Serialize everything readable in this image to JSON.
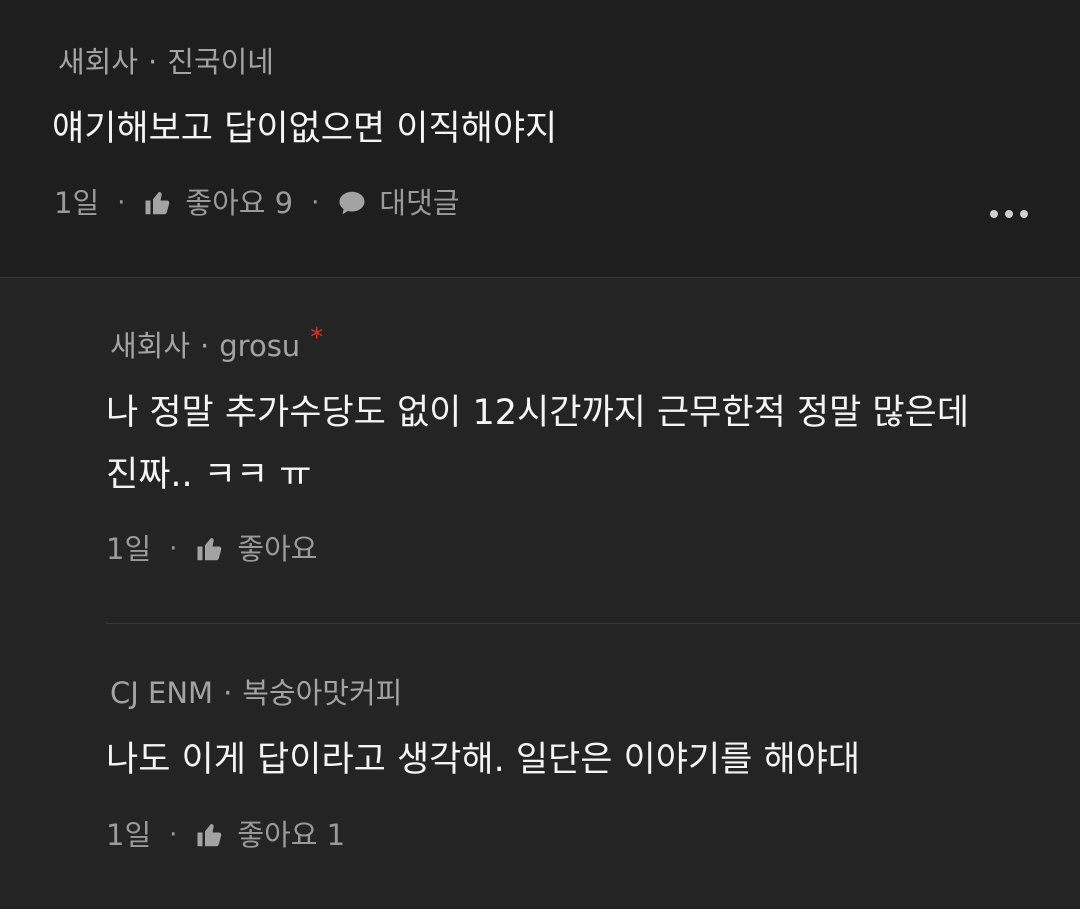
{
  "comments": [
    {
      "company": "새회사",
      "author": "진국이네",
      "text": "얘기해보고 답이없으면 이직해야지",
      "time": "1일",
      "like_label": "좋아요 9",
      "reply_label": "대댓글"
    }
  ],
  "replies": [
    {
      "company": "새회사",
      "author": "grosu",
      "author_mark": "*",
      "text_line1": "나 정말 추가수당도 없이 12시간까지 근무한적 정말 많은데",
      "text_line2": "진짜.. ㅋㅋ ㅠ",
      "time": "1일",
      "like_label": "좋아요"
    },
    {
      "company": "CJ ENM",
      "author": "복숭아맛커피",
      "text": "나도 이게 답이라고 생각해. 일단은 이야기를 해야대",
      "time": "1일",
      "like_label": "좋아요 1"
    }
  ],
  "separator": "·",
  "icons": {
    "like": "thumbs-up-icon",
    "reply": "speech-bubble-icon",
    "more": "more-dots-icon"
  },
  "colors": {
    "top_background": "#1e1e1e",
    "reply_background": "#242424",
    "text": "#f4f4f4",
    "muted": "#a3a3a3",
    "mark": "#d9322e"
  }
}
